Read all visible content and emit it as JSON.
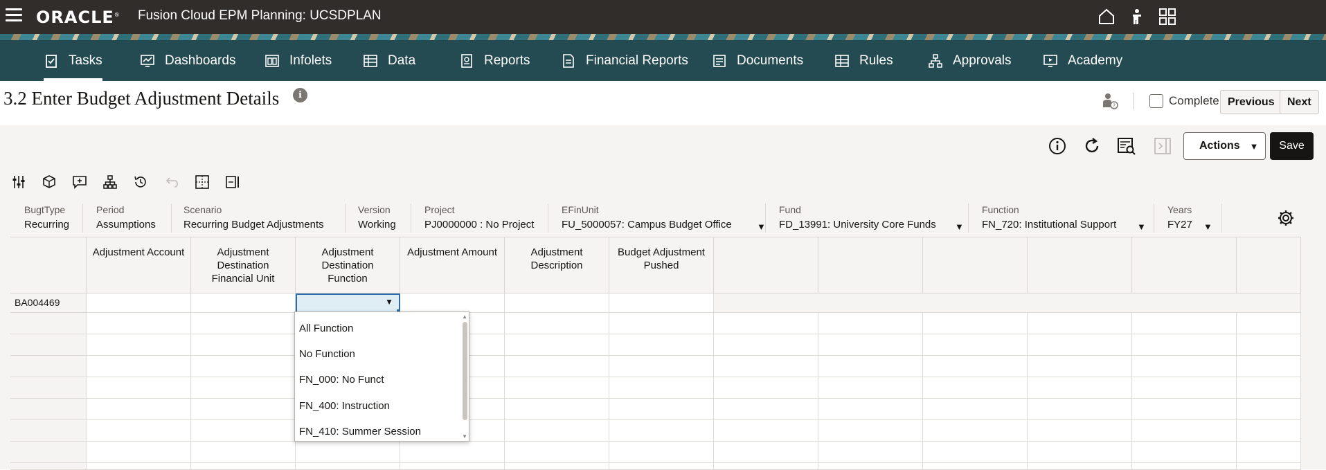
{
  "header": {
    "logo": "ORACLE",
    "app_title": "Fusion Cloud EPM Planning:  UCSDPLAN"
  },
  "nav": [
    {
      "label": "Tasks",
      "icon": "clipboard-icon",
      "active": true
    },
    {
      "label": "Dashboards",
      "icon": "chart-icon"
    },
    {
      "label": "Infolets",
      "icon": "infolet-icon"
    },
    {
      "label": "Data",
      "icon": "table-icon"
    },
    {
      "label": "Reports",
      "icon": "report-icon"
    },
    {
      "label": "Financial Reports",
      "icon": "financial-report-icon"
    },
    {
      "label": "Documents",
      "icon": "document-icon"
    },
    {
      "label": "Rules",
      "icon": "rules-icon"
    },
    {
      "label": "Approvals",
      "icon": "approvals-icon"
    },
    {
      "label": "Academy",
      "icon": "academy-icon"
    }
  ],
  "page": {
    "title": "3.2 Enter Budget Adjustment Details",
    "info": "i",
    "complete_label": "Complete",
    "previous_label": "Previous",
    "next_label": "Next"
  },
  "toolbar": {
    "actions_label": "Actions",
    "save_label": "Save"
  },
  "pov": [
    {
      "label": "BugtType",
      "value": "Recurring"
    },
    {
      "label": "Period",
      "value": "Assumptions"
    },
    {
      "label": "Scenario",
      "value": "Recurring Budget Adjustments"
    },
    {
      "label": "Version",
      "value": "Working"
    },
    {
      "label": "Project",
      "value": "PJ0000000 : No Project"
    },
    {
      "label": "EFinUnit",
      "value": "FU_5000057: Campus Budget Office"
    },
    {
      "label": "Fund",
      "value": "FD_13991: University Core Funds"
    },
    {
      "label": "Function",
      "value": "FN_720: Institutional Support"
    },
    {
      "label": "Years",
      "value": "FY27"
    }
  ],
  "grid": {
    "columns": [
      "Adjustment Account",
      "Adjustment Destination Financial Unit",
      "Adjustment Destination Function",
      "Adjustment Amount",
      "Adjustment Description",
      "Budget Adjustment Pushed"
    ],
    "rows": [
      "BA004469"
    ]
  },
  "dropdown": {
    "options": [
      "All Function",
      "No Function",
      "FN_000: No Funct",
      "FN_400: Instruction",
      "FN_410: Summer Session"
    ]
  },
  "colors": {
    "header_bg": "#312d2a",
    "nav_bg": "#254b52",
    "accent": "#2d6da3"
  }
}
